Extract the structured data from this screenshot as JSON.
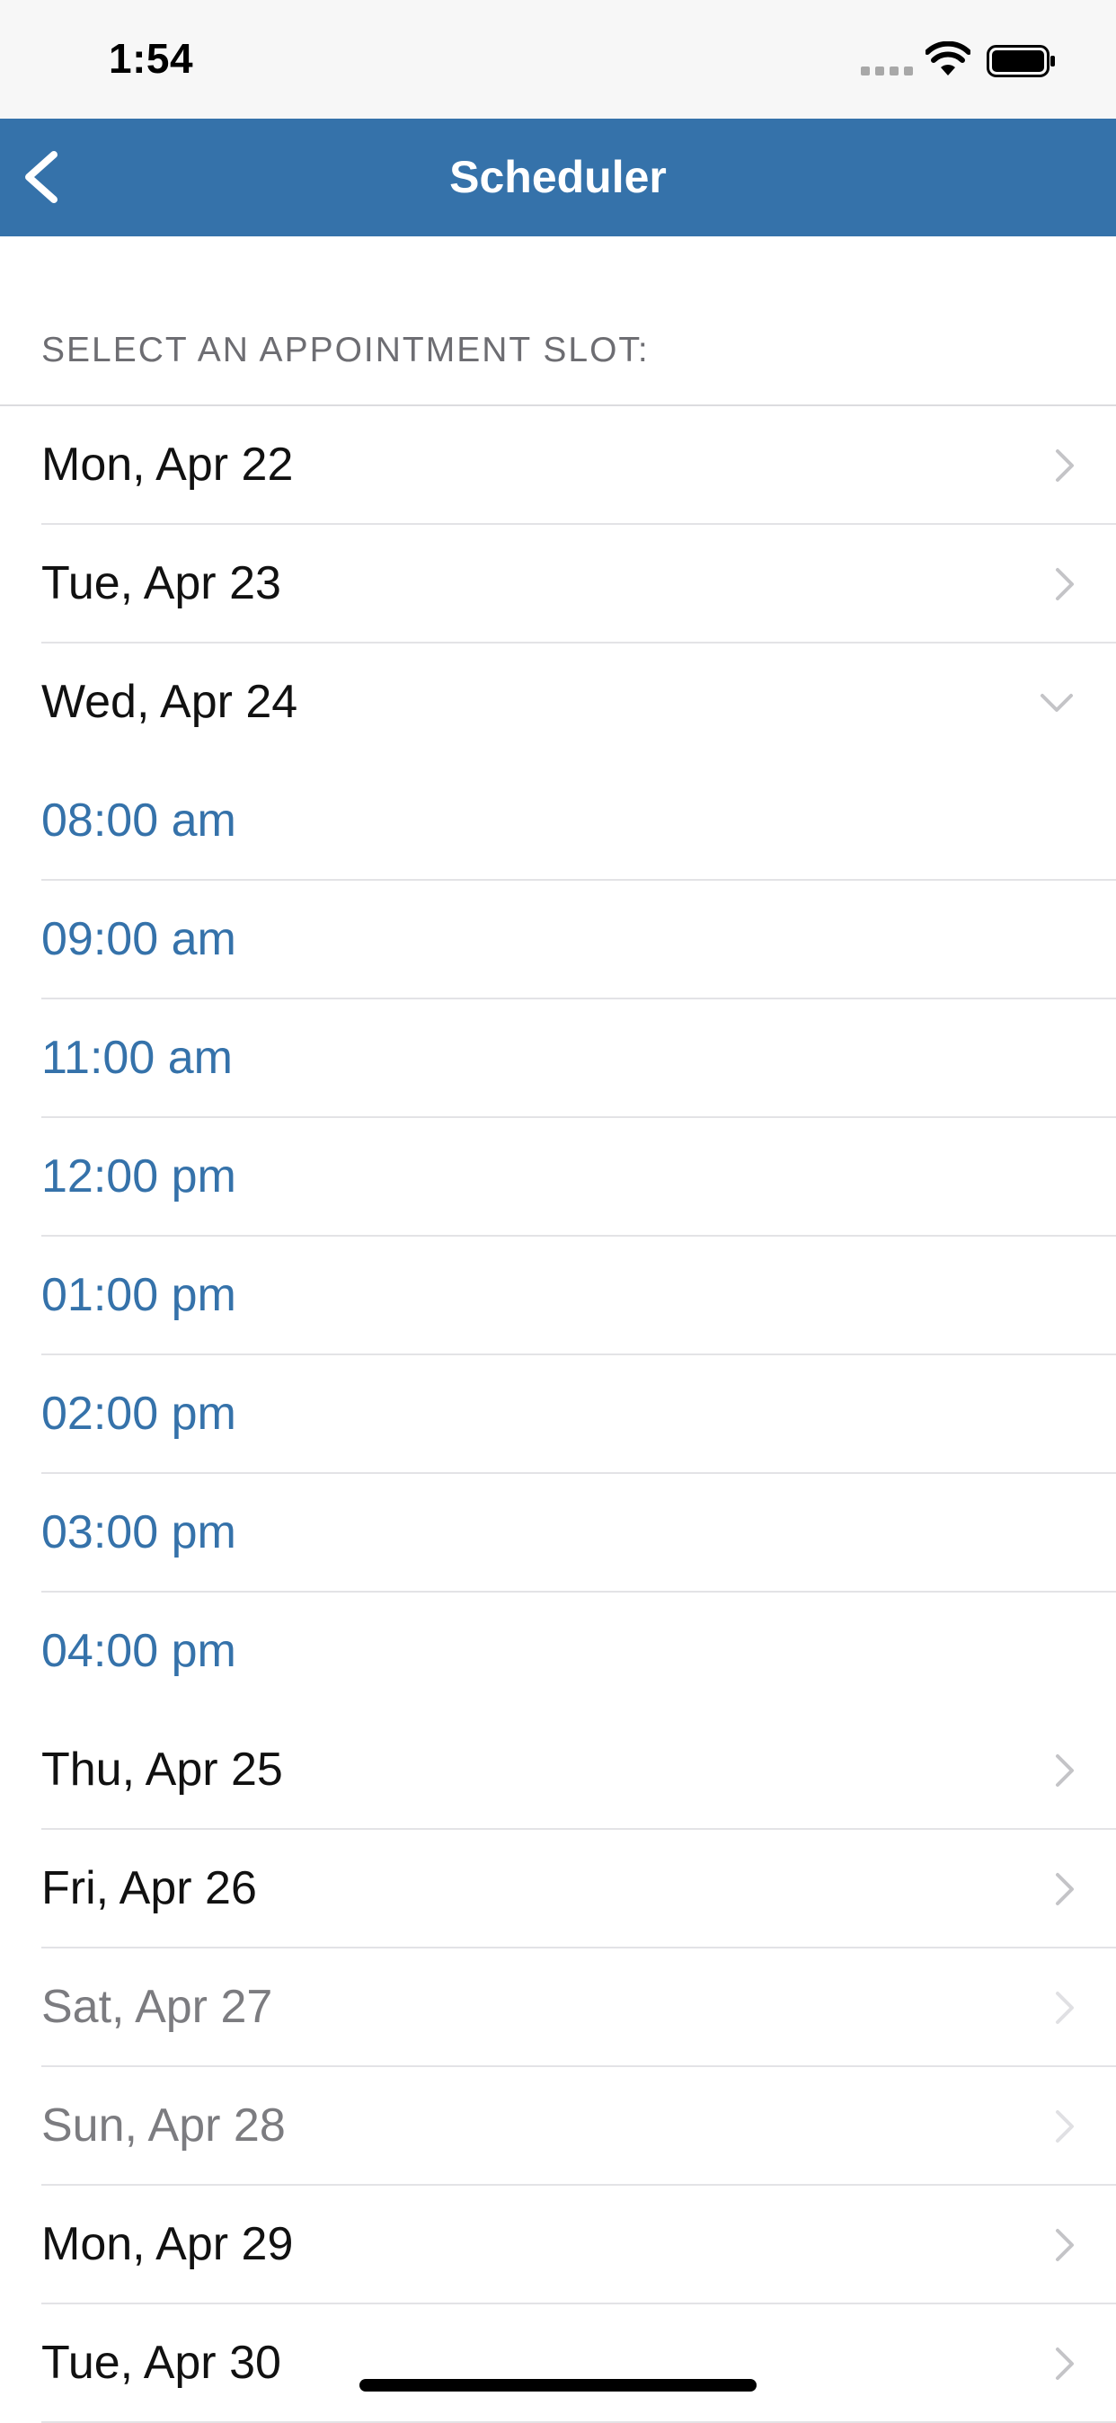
{
  "status_bar": {
    "time": "1:54"
  },
  "nav": {
    "title": "Scheduler"
  },
  "section_header": "SELECT AN APPOINTMENT SLOT:",
  "days": [
    {
      "label": "Mon, Apr 22"
    },
    {
      "label": "Tue, Apr 23"
    },
    {
      "label": "Wed, Apr 24"
    },
    {
      "label": "Thu, Apr 25"
    },
    {
      "label": "Fri, Apr 26"
    },
    {
      "label": "Sat, Apr 27"
    },
    {
      "label": "Sun, Apr 28"
    },
    {
      "label": "Mon, Apr 29"
    },
    {
      "label": "Tue, Apr 30"
    }
  ],
  "slots": [
    {
      "label": "08:00 am"
    },
    {
      "label": "09:00 am"
    },
    {
      "label": "11:00 am"
    },
    {
      "label": "12:00 pm"
    },
    {
      "label": "01:00 pm"
    },
    {
      "label": "02:00 pm"
    },
    {
      "label": "03:00 pm"
    },
    {
      "label": "04:00 pm"
    }
  ],
  "colors": {
    "nav_background": "#3572aa",
    "slot_text": "#3572aa",
    "disabled_text": "#7c7c80"
  }
}
